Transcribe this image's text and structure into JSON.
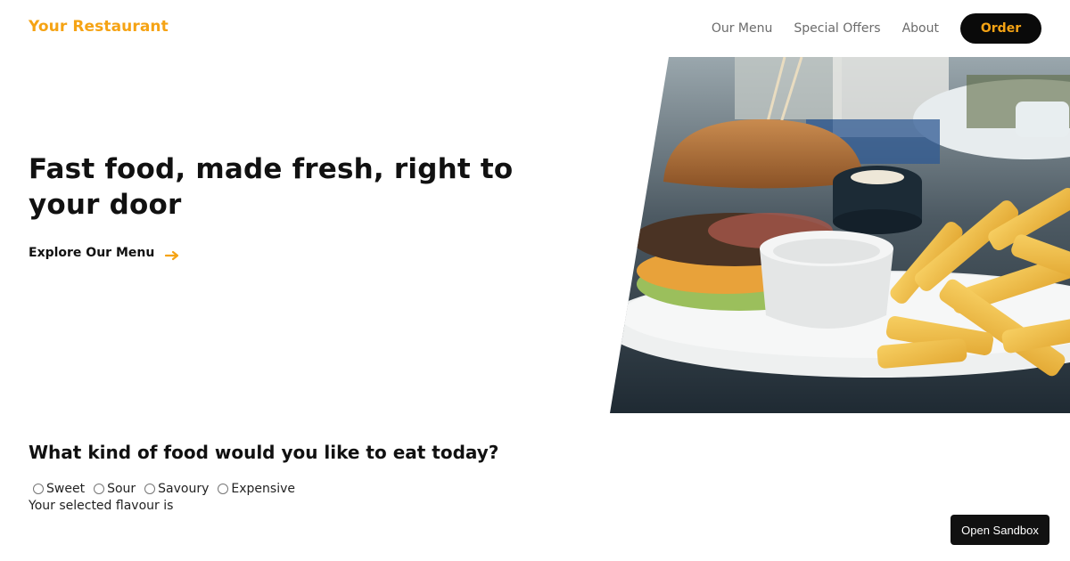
{
  "header": {
    "brand": "Your Restaurant",
    "nav": [
      {
        "label": "Our Menu"
      },
      {
        "label": "Special Offers"
      },
      {
        "label": "About"
      }
    ],
    "order_label": "Order"
  },
  "hero": {
    "title": "Fast food, made fresh, right to your door",
    "cta_label": "Explore Our Menu",
    "cta_icon": "arrow-right-icon",
    "image": "burger-and-fries-photo"
  },
  "survey": {
    "question": "What kind of food would you like to eat today?",
    "options": [
      "Sweet",
      "Sour",
      "Savoury",
      "Expensive"
    ],
    "result_label": "Your selected flavour is"
  },
  "sandbox_label": "Open Sandbox",
  "colors": {
    "accent": "#f5a314",
    "button_bg": "#0a0a0a",
    "text": "#111111",
    "nav_text": "#6b6b6b"
  }
}
